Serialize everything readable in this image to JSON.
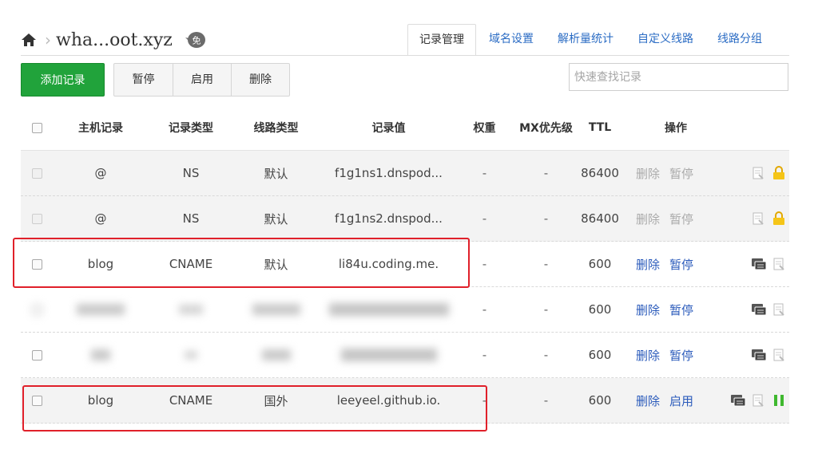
{
  "breadcrumb": {
    "domain": "wha...oot.xyz",
    "badge": "免"
  },
  "tabs": [
    {
      "label": "记录管理",
      "active": true
    },
    {
      "label": "域名设置"
    },
    {
      "label": "解析量统计"
    },
    {
      "label": "自定义线路"
    },
    {
      "label": "线路分组"
    }
  ],
  "toolbar": {
    "add_label": "添加记录",
    "pause_label": "暂停",
    "enable_label": "启用",
    "delete_label": "删除",
    "search_placeholder": "快速查找记录"
  },
  "table": {
    "headers": {
      "host": "主机记录",
      "type": "记录类型",
      "line": "线路类型",
      "value": "记录值",
      "weight": "权重",
      "mx": "MX优先级",
      "ttl": "TTL",
      "ops": "操作"
    },
    "rows": [
      {
        "host": "@",
        "type": "NS",
        "line": "默认",
        "value": "f1g1ns1.dnspod...",
        "weight": "-",
        "mx": "-",
        "ttl": "86400",
        "op1": "删除",
        "op2": "暂停"
      },
      {
        "host": "@",
        "type": "NS",
        "line": "默认",
        "value": "f1g1ns2.dnspod...",
        "weight": "-",
        "mx": "-",
        "ttl": "86400",
        "op1": "删除",
        "op2": "暂停"
      },
      {
        "host": "blog",
        "type": "CNAME",
        "line": "默认",
        "value": "li84u.coding.me.",
        "weight": "-",
        "mx": "-",
        "ttl": "600",
        "op1": "删除",
        "op2": "暂停"
      },
      {
        "host": "",
        "type": "",
        "line": "",
        "value": "",
        "weight": "-",
        "mx": "-",
        "ttl": "600",
        "op1": "删除",
        "op2": "暂停"
      },
      {
        "host": "",
        "type": "",
        "line": "",
        "value": "",
        "weight": "-",
        "mx": "-",
        "ttl": "600",
        "op1": "删除",
        "op2": "暂停"
      },
      {
        "host": "blog",
        "type": "CNAME",
        "line": "国外",
        "value": "leeyeel.github.io.",
        "weight": "-",
        "mx": "-",
        "ttl": "600",
        "op1": "删除",
        "op2": "启用"
      }
    ]
  },
  "colors": {
    "accent_green": "#21a33b",
    "link_blue": "#2b5bbb",
    "highlight_red": "#e0202a",
    "lock_yellow": "#f0b800"
  }
}
